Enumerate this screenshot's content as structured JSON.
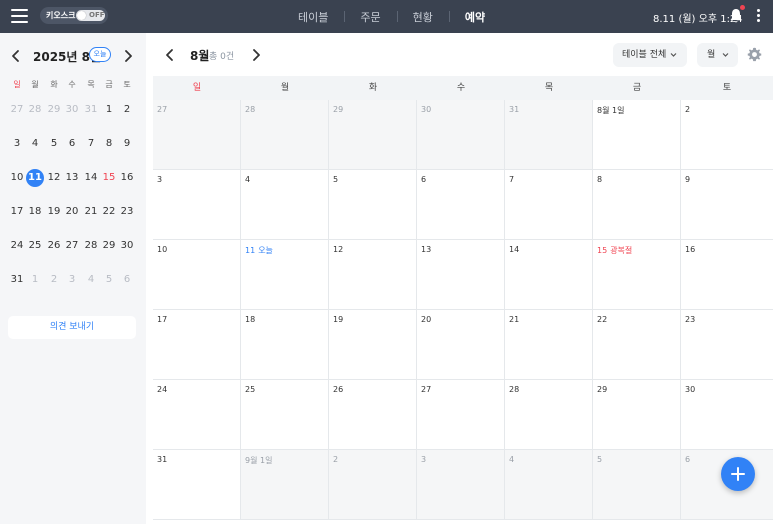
{
  "topbar": {
    "kiosk_label": "키오스크",
    "kiosk_state": "OFF",
    "nav": [
      "테이블",
      "주문",
      "현황",
      "예약"
    ],
    "active_nav": "예약",
    "datetime": "8.11 (월) 오후 1:24",
    "icons": [
      "menu-icon",
      "bell-icon",
      "more-vertical-icon"
    ],
    "notification_dot_color": "#f04452"
  },
  "mini_calendar": {
    "title": "2025년 8월",
    "today_label": "오늘",
    "weekdays": [
      "일",
      "월",
      "화",
      "수",
      "목",
      "금",
      "토"
    ],
    "weeks": [
      [
        "27",
        "28",
        "29",
        "30",
        "31",
        "1",
        "2"
      ],
      [
        "3",
        "4",
        "5",
        "6",
        "7",
        "8",
        "9"
      ],
      [
        "10",
        "11",
        "12",
        "13",
        "14",
        "15",
        "16"
      ],
      [
        "17",
        "18",
        "19",
        "20",
        "21",
        "22",
        "23"
      ],
      [
        "24",
        "25",
        "26",
        "27",
        "28",
        "29",
        "30"
      ],
      [
        "31",
        "1",
        "2",
        "3",
        "4",
        "5",
        "6"
      ]
    ],
    "selected_day": "11",
    "holiday_day": "15",
    "feedback_button": "의견 보내기"
  },
  "main": {
    "month_title": "8월",
    "count_text": "총 0건",
    "table_filter": "테이블 전체",
    "view_select": "월",
    "weekdays": [
      "일",
      "월",
      "화",
      "수",
      "목",
      "금",
      "토"
    ],
    "weeks": [
      [
        "27",
        "28",
        "29",
        "30",
        "31",
        "8월 1일",
        "2"
      ],
      [
        "3",
        "4",
        "5",
        "6",
        "7",
        "8",
        "9"
      ],
      [
        "10",
        "11",
        "12",
        "13",
        "14",
        "15",
        "16"
      ],
      [
        "17",
        "18",
        "19",
        "20",
        "21",
        "22",
        "23"
      ],
      [
        "24",
        "25",
        "26",
        "27",
        "28",
        "29",
        "30"
      ],
      [
        "31",
        "9월 1일",
        "2",
        "3",
        "4",
        "5",
        "6"
      ]
    ],
    "today_label": "오늘",
    "holiday_label": "광복절",
    "accent_color": "#3182f6",
    "holiday_color": "#f04452"
  }
}
